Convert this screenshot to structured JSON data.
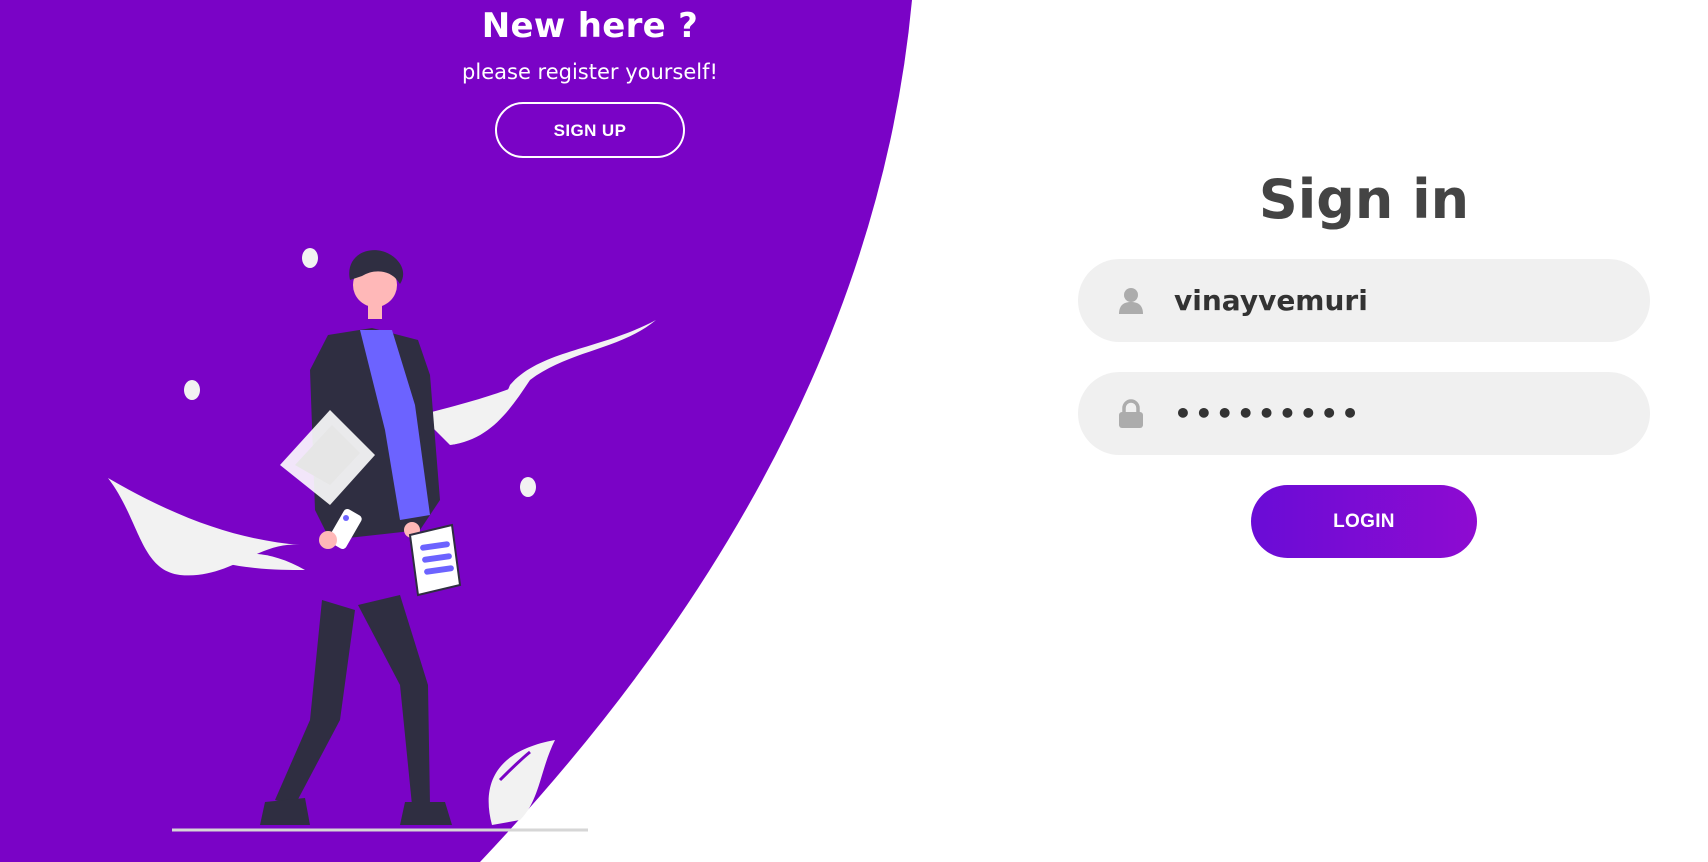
{
  "panel": {
    "heading": "New here ?",
    "subtext": "please register yourself!",
    "signup_label": "SIGN UP"
  },
  "form": {
    "title": "Sign in",
    "username_value": "vinayvemuri",
    "password_value": "•••••••••",
    "login_label": "LOGIN",
    "username_icon": "user-icon",
    "password_icon": "lock-icon"
  },
  "colors": {
    "primary": "#7a03c6",
    "title_text": "#444444",
    "input_bg": "#f0f0f0",
    "button_gradient_start": "#6a0cd6",
    "button_gradient_end": "#8e0bd1"
  }
}
